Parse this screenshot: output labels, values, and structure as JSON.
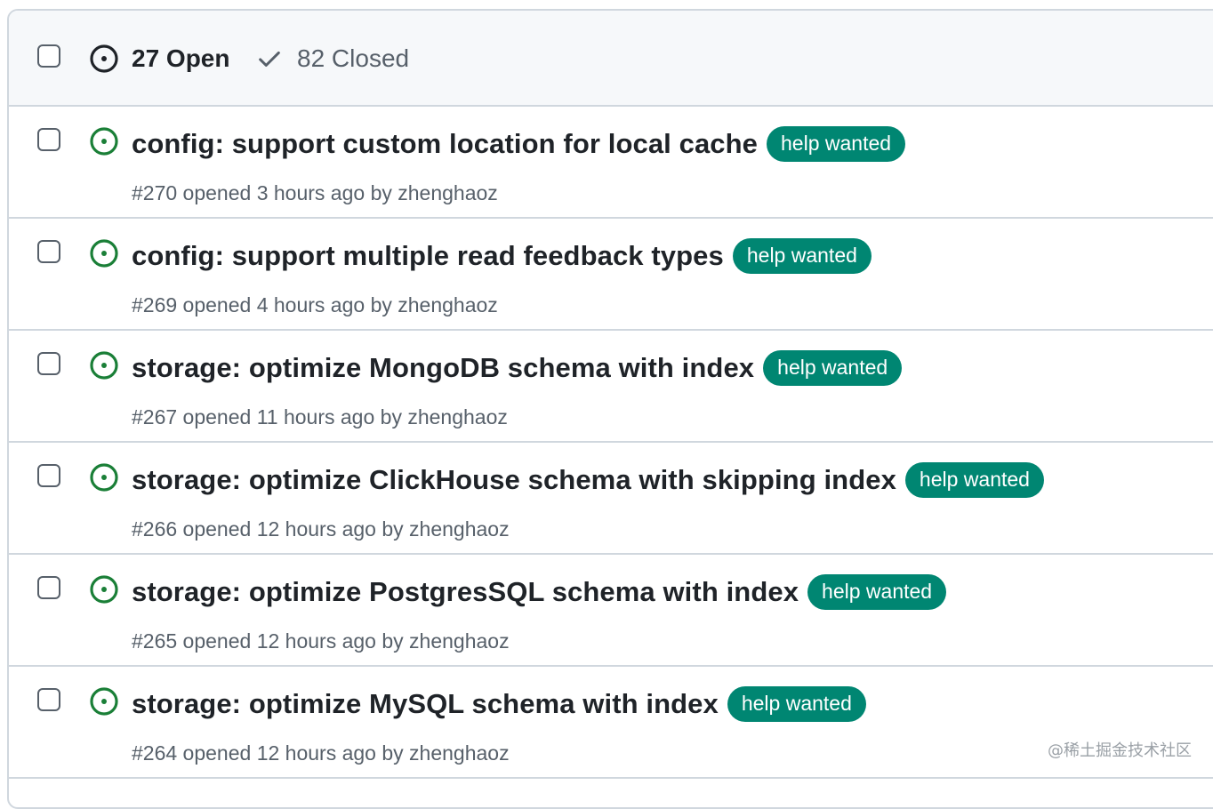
{
  "header": {
    "open_label": "27 Open",
    "closed_label": "82 Closed"
  },
  "issues": [
    {
      "title": "config: support custom location for local cache",
      "label": "help wanted",
      "meta": "#270 opened 3 hours ago by zhenghaoz"
    },
    {
      "title": "config: support multiple read feedback types",
      "label": "help wanted",
      "meta": "#269 opened 4 hours ago by zhenghaoz"
    },
    {
      "title": "storage: optimize MongoDB schema with index",
      "label": "help wanted",
      "meta": "#267 opened 11 hours ago by zhenghaoz"
    },
    {
      "title": "storage: optimize ClickHouse schema with skipping index",
      "label": "help wanted",
      "meta": "#266 opened 12 hours ago by zhenghaoz"
    },
    {
      "title": "storage: optimize PostgresSQL schema with index",
      "label": "help wanted",
      "meta": "#265 opened 12 hours ago by zhenghaoz"
    },
    {
      "title": "storage: optimize MySQL schema with index",
      "label": "help wanted",
      "meta": "#264 opened 12 hours ago by zhenghaoz"
    }
  ],
  "watermark": "@稀土掘金技术社区",
  "colors": {
    "open_icon": "#1a7f37",
    "label_bg": "#008672",
    "border": "#d0d7de",
    "header_bg": "#f6f8fa"
  },
  "icons": {
    "open": "issue-opened-icon",
    "closed": "check-icon"
  }
}
